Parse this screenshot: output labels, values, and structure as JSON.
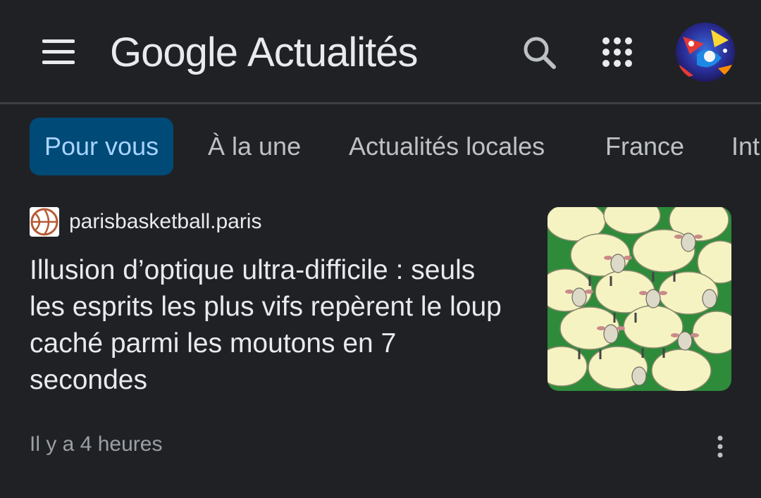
{
  "app": {
    "brand_google": "Google",
    "brand_product": "Actualités"
  },
  "icons": {
    "menu": "menu-icon",
    "search": "search-icon",
    "apps": "apps-grid-icon",
    "avatar": "user-avatar",
    "more": "more-vert-icon"
  },
  "tabs": [
    {
      "label": "Pour vous",
      "active": true
    },
    {
      "label": "À la une",
      "active": false
    },
    {
      "label": "Actualités locales",
      "active": false
    },
    {
      "label": "France",
      "active": false
    },
    {
      "label": "Int",
      "active": false
    }
  ],
  "article": {
    "source": "parisbasketball.paris",
    "headline": "Illusion d’optique ultra-difficile : seuls les esprits les plus vifs repèrent le loup caché parmi les moutons en 7 secondes",
    "time": "Il y a 4 heures"
  },
  "colors": {
    "background": "#202124",
    "text": "#e8eaed",
    "active_tab_bg": "#004a77",
    "active_tab_text": "#a8d4ff",
    "muted": "#9aa0a6",
    "divider": "#3c4043"
  }
}
